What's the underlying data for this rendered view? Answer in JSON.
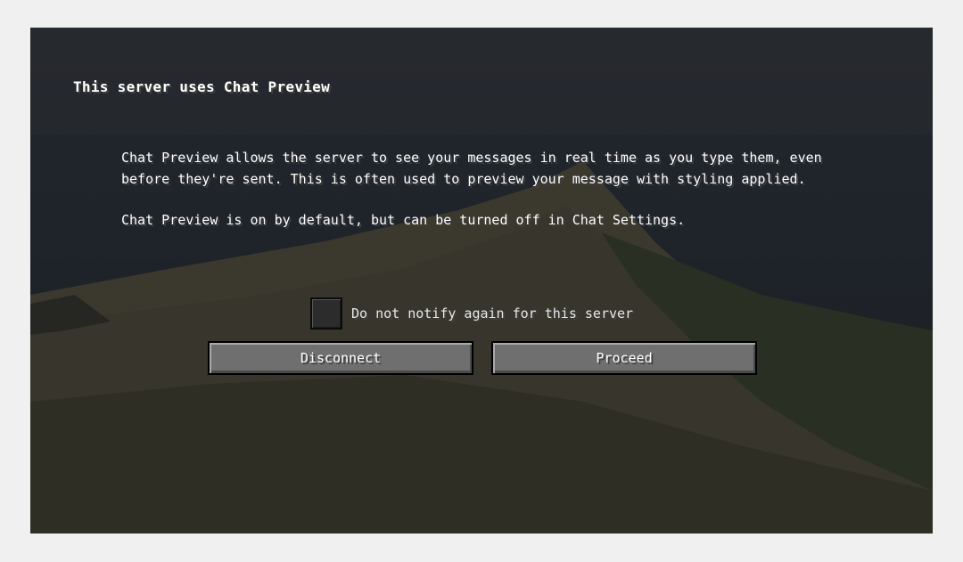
{
  "screen": {
    "title": "This server uses Chat Preview",
    "body": [
      "Chat Preview allows the server to see your messages in real time as you type them, even before they're sent. This is often used to preview your message with styling applied.",
      "Chat Preview is on by default, but can be turned off in Chat Settings."
    ]
  },
  "checkbox": {
    "label": "Do not notify again for this server",
    "checked": false
  },
  "buttons": {
    "disconnect": "Disconnect",
    "proceed": "Proceed"
  }
}
